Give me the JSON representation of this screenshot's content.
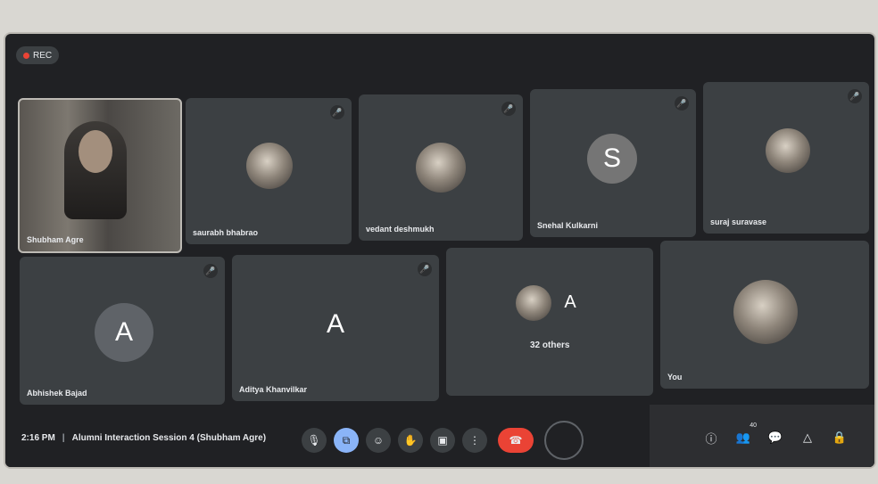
{
  "meeting": {
    "recording_label": "REC",
    "time": "2:16 PM",
    "title": "Alumni Interaction Session 4 (Shubham Agre)"
  },
  "participants_row1": [
    {
      "name": "Shubham Agre",
      "type": "camera"
    },
    {
      "name": "saurabh bhabrao",
      "type": "photo"
    },
    {
      "name": "vedant deshmukh",
      "type": "photo"
    },
    {
      "name": "Snehal Kulkarni",
      "type": "letter",
      "letter": "S"
    },
    {
      "name": "suraj suravase",
      "type": "photo"
    }
  ],
  "participants_row2": [
    {
      "name": "Abhishek Bajad",
      "type": "letter",
      "letter": "A"
    },
    {
      "name": "Aditya Khanvilkar",
      "type": "letter",
      "letter": "A"
    },
    {
      "name": "32 others",
      "type": "group",
      "letter": "A"
    },
    {
      "name": "You",
      "type": "photo"
    }
  ],
  "controls": {
    "participant_count": "40"
  },
  "icons": [
    "mic-icon",
    "captions-icon",
    "emoji-icon",
    "raise-hand-icon",
    "present-icon",
    "more-options-icon",
    "end-call-icon",
    "info-icon",
    "people-icon",
    "chat-icon",
    "activities-icon",
    "host-controls-icon"
  ],
  "colors": {
    "background": "#202124",
    "tile": "#3c4043",
    "end_call": "#ea4335",
    "rec": "#ea4335"
  }
}
